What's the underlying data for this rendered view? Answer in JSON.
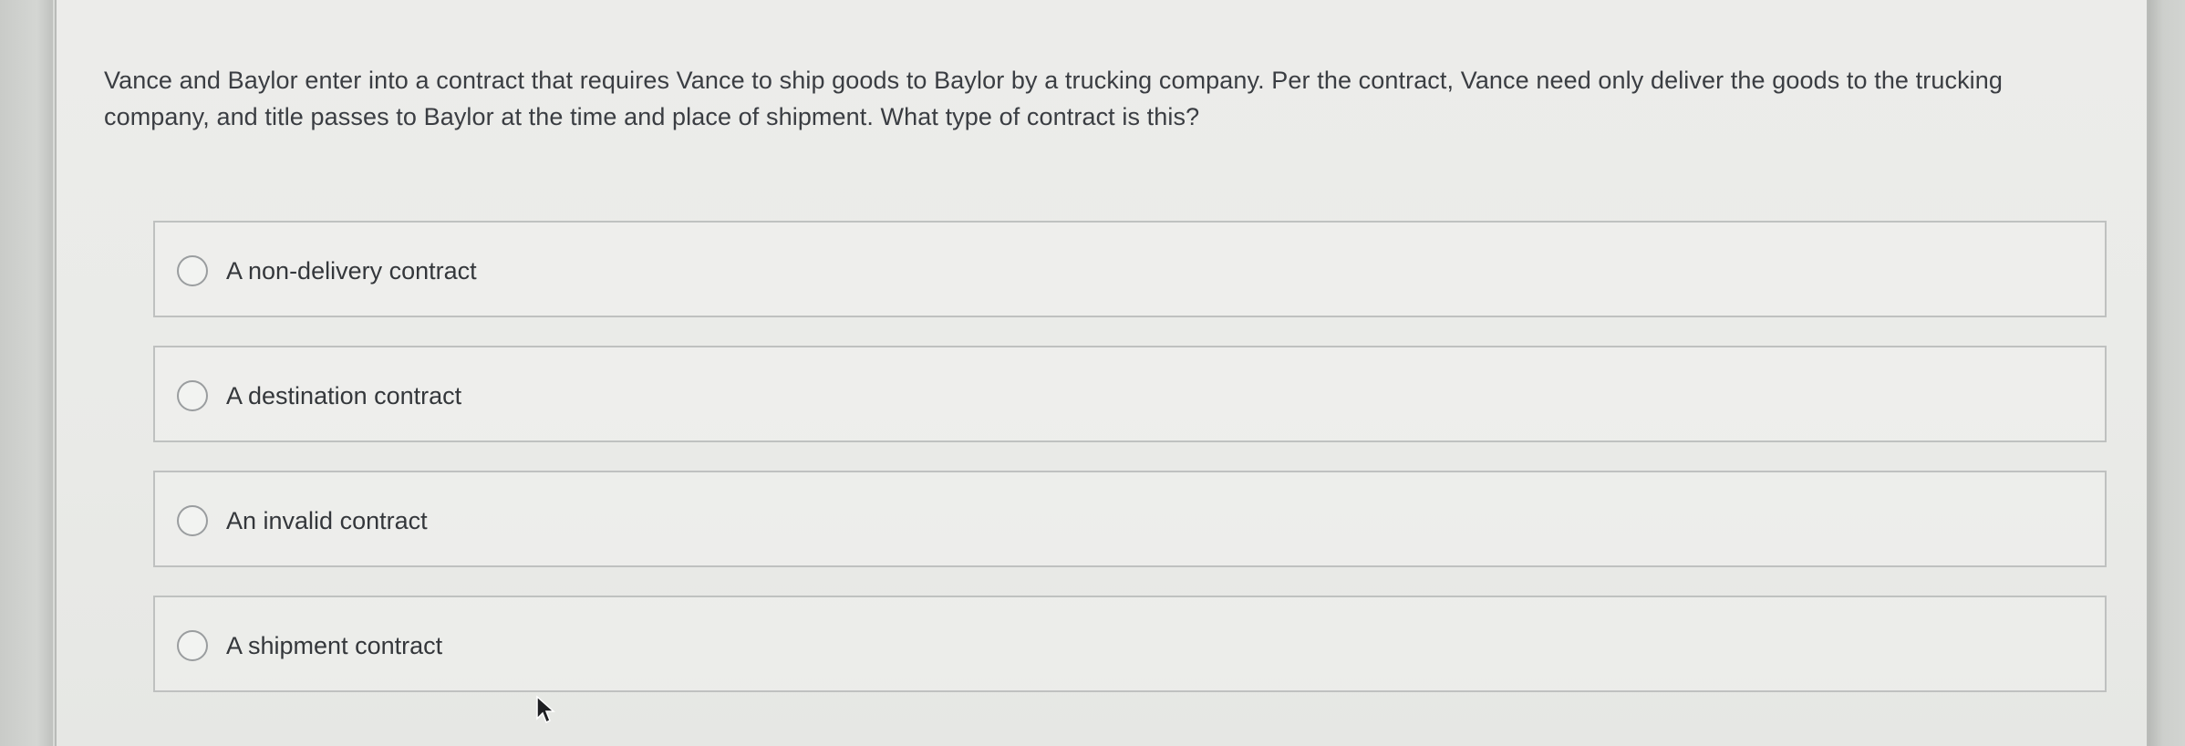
{
  "question": {
    "text": "Vance and Baylor enter into a contract that requires Vance to ship goods to Baylor by a trucking company. Per the contract, Vance need only deliver the goods to the trucking company, and title passes to Baylor at the time and place of shipment. What type of contract is this?"
  },
  "options": [
    {
      "label": "A non-delivery contract"
    },
    {
      "label": "A destination contract"
    },
    {
      "label": "An invalid contract"
    },
    {
      "label": "A shipment contract"
    }
  ],
  "icons": {
    "radio": "radio-button-icon",
    "cursor": "mouse-pointer-icon"
  }
}
